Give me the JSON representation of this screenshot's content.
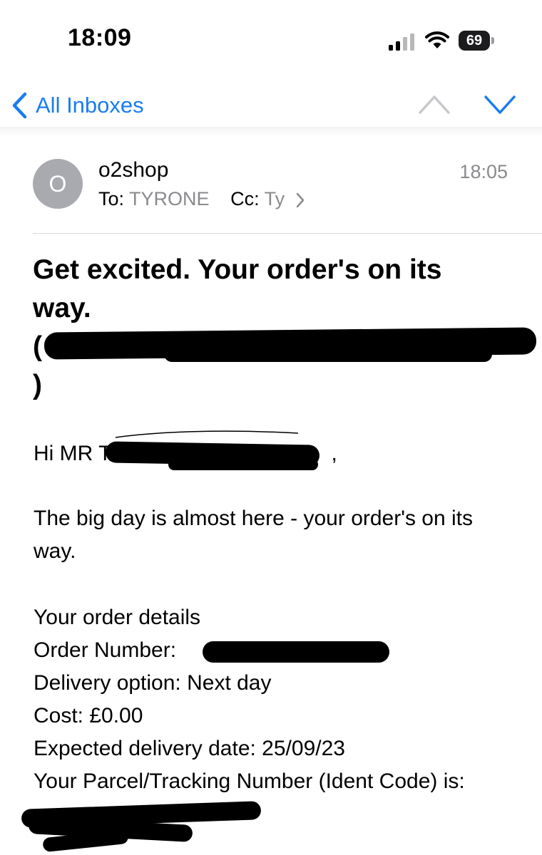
{
  "status": {
    "time": "18:09",
    "battery": "69"
  },
  "nav": {
    "back_label": "All Inboxes"
  },
  "message": {
    "avatar_initial": "O",
    "sender": "o2shop",
    "time": "18:05",
    "to_label": "To:",
    "to_value": "TYRONE",
    "cc_label": "Cc:",
    "cc_value": "Ty"
  },
  "email": {
    "subject_line1": "Get excited. Your order's on its",
    "subject_line2": "way.",
    "subject_line3": "(",
    "subject_line4": ")",
    "greeting_prefix": "Hi MR T",
    "greeting_suffix": ",",
    "intro": "The big day is almost here - your order's on its way.",
    "details_heading": "Your order details",
    "order_number_label": "Order Number:",
    "delivery_option": "Delivery option:  Next day",
    "cost": "Cost:  £0.00",
    "expected_delivery": "Expected delivery date:  25/09/23",
    "tracking_label": "Your Parcel/Tracking Number (Ident Code) is:"
  }
}
